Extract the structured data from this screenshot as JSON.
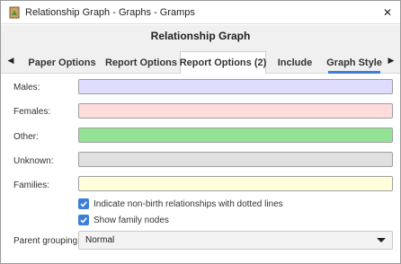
{
  "window": {
    "title": "Relationship Graph - Graphs - Gramps",
    "close_glyph": "✕"
  },
  "dialog": {
    "title": "Relationship Graph"
  },
  "tabs": {
    "left_arrow": "◀",
    "right_arrow": "▶",
    "items": [
      {
        "label": "Paper Options"
      },
      {
        "label": "Report Options"
      },
      {
        "label": "Report Options (2)"
      },
      {
        "label": "Include"
      },
      {
        "label": "Graph Style"
      }
    ],
    "active_index": 4
  },
  "graph_style": {
    "males_label": "Males:",
    "males_color": "#dedcff",
    "females_label": "Females:",
    "females_color": "#ffdcdc",
    "other_label": "Other:",
    "other_color": "#94e294",
    "unknown_label": "Unknown:",
    "unknown_color": "#e0e0e0",
    "families_label": "Families:",
    "families_color": "#ffffdc",
    "dotted_lines_label": "Indicate non-birth relationships with dotted lines",
    "dotted_lines_checked": true,
    "family_nodes_label": "Show family nodes",
    "family_nodes_checked": true,
    "parent_grouping_label": "Parent grouping:",
    "parent_grouping_value": "Normal"
  },
  "colors": {
    "accent": "#3c7fd8"
  },
  "icons": {
    "app": "gramps-app-icon",
    "close": "close-icon",
    "checkbox": "checkmark-icon",
    "dropdown": "dropdown-arrow-icon"
  }
}
